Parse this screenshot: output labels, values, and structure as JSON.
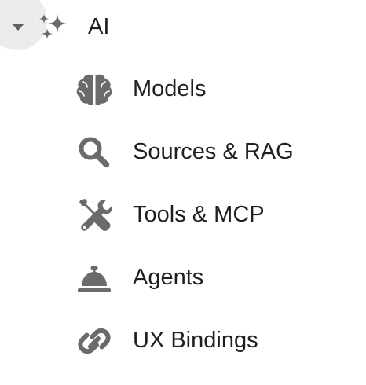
{
  "group": {
    "label": "AI",
    "icon": "sparkles-icon",
    "expanded": true
  },
  "items": [
    {
      "label": "Models",
      "icon": "brain-icon"
    },
    {
      "label": "Sources & RAG",
      "icon": "search-icon"
    },
    {
      "label": "Tools & MCP",
      "icon": "tools-icon"
    },
    {
      "label": "Agents",
      "icon": "service-bell-icon"
    },
    {
      "label": "UX Bindings",
      "icon": "link-icon"
    }
  ],
  "colors": {
    "icon": "#6b6b6b",
    "text": "#1f1f1f",
    "toggle_background": "#ececec"
  }
}
